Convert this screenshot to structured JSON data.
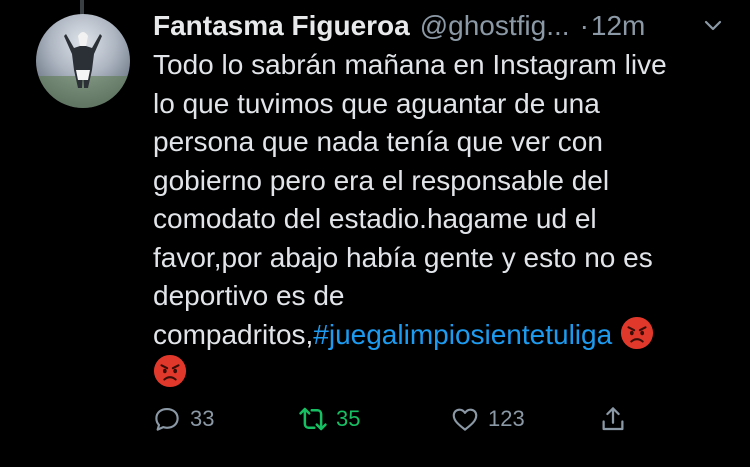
{
  "tweet": {
    "display_name": "Fantasma Figueroa",
    "handle": "@ghostfig...",
    "separator": "·",
    "time": "12m",
    "lines": [
      "Todo lo sabrán mañana en Instagram live",
      "lo que tuvimos que aguantar de una",
      "persona que nada tenía que ver con",
      "gobierno pero era el responsable del",
      "comodato del estadio.hagame ud el",
      "favor,por abajo había gente y esto no es",
      "deportivo es de"
    ],
    "last_line_prefix": "compadritos,",
    "hashtag": "#juegalimpiosientetuliga",
    "emoji": "angry-face"
  },
  "actions": {
    "replies": "33",
    "retweets": "35",
    "likes": "123"
  },
  "colors": {
    "background": "#000000",
    "text": "#e1e4e8",
    "secondary": "#8b98a5",
    "link": "#1d9bf0",
    "retweet_active": "#17bf63"
  }
}
